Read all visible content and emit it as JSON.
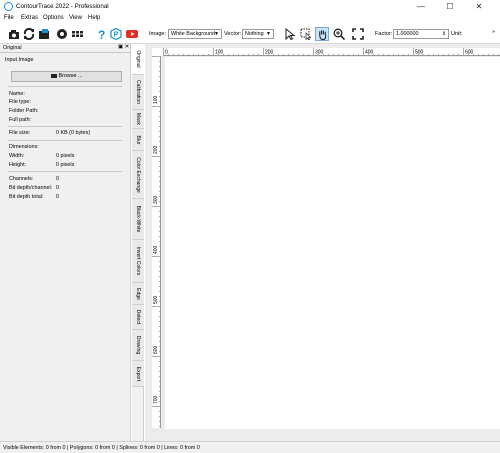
{
  "window": {
    "title": "ContourTrace 2022 - Professional",
    "controls": [
      "—",
      "☐",
      "✕"
    ]
  },
  "menu": [
    "File",
    "Extras",
    "Options",
    "View",
    "Help"
  ],
  "toolbar": {
    "image_label": "Image:",
    "image_value": "White Background",
    "vector_label": "Vector:",
    "vector_value": "Nothing",
    "factor_label": "Factor:",
    "factor_value": "1.000000",
    "unit_label": "Unit:",
    "overflow": "»"
  },
  "panel": {
    "title": "Original",
    "header_buttons": "▣ ✕",
    "section": "Input Image",
    "browse_label": "Browse ...",
    "fields": {
      "name": "Name:",
      "file_type": "File type:",
      "folder_path": "Folder Path:",
      "full_path": "Full path:",
      "file_size": "File size:",
      "file_size_value": "0 KB (0 bytes)",
      "dimensions": "Dimensions:",
      "width": "Width:",
      "width_value": "0 pixels",
      "height": "Height:",
      "height_value": "0 pixels",
      "channels": "Channels:",
      "channels_value": "0",
      "bit_depth_channel": "Bit depth/channel:",
      "bit_depth_channel_value": "0",
      "bit_depth_total": "Bit depth total:",
      "bit_depth_total_value": "0"
    }
  },
  "tabs": [
    "Original",
    "Calibration",
    "Mask",
    "Blur",
    "Color Exchange",
    "Black-White",
    "Invert Colors",
    "Edge",
    "Detect",
    "Drawing",
    "Export"
  ],
  "ruler": {
    "h": [
      "0",
      "100",
      "200",
      "300",
      "400",
      "500",
      "600"
    ],
    "v": [
      "100",
      "200",
      "300",
      "400",
      "500",
      "600",
      "700"
    ]
  },
  "status": "Visible Elements: 0 from 0 | Polygons: 0 from 0 | Splines: 0 from 0 | Lines: 0 from 0",
  "colors": {
    "accent": "#1b8fd6",
    "panel": "#f0f0f0"
  }
}
